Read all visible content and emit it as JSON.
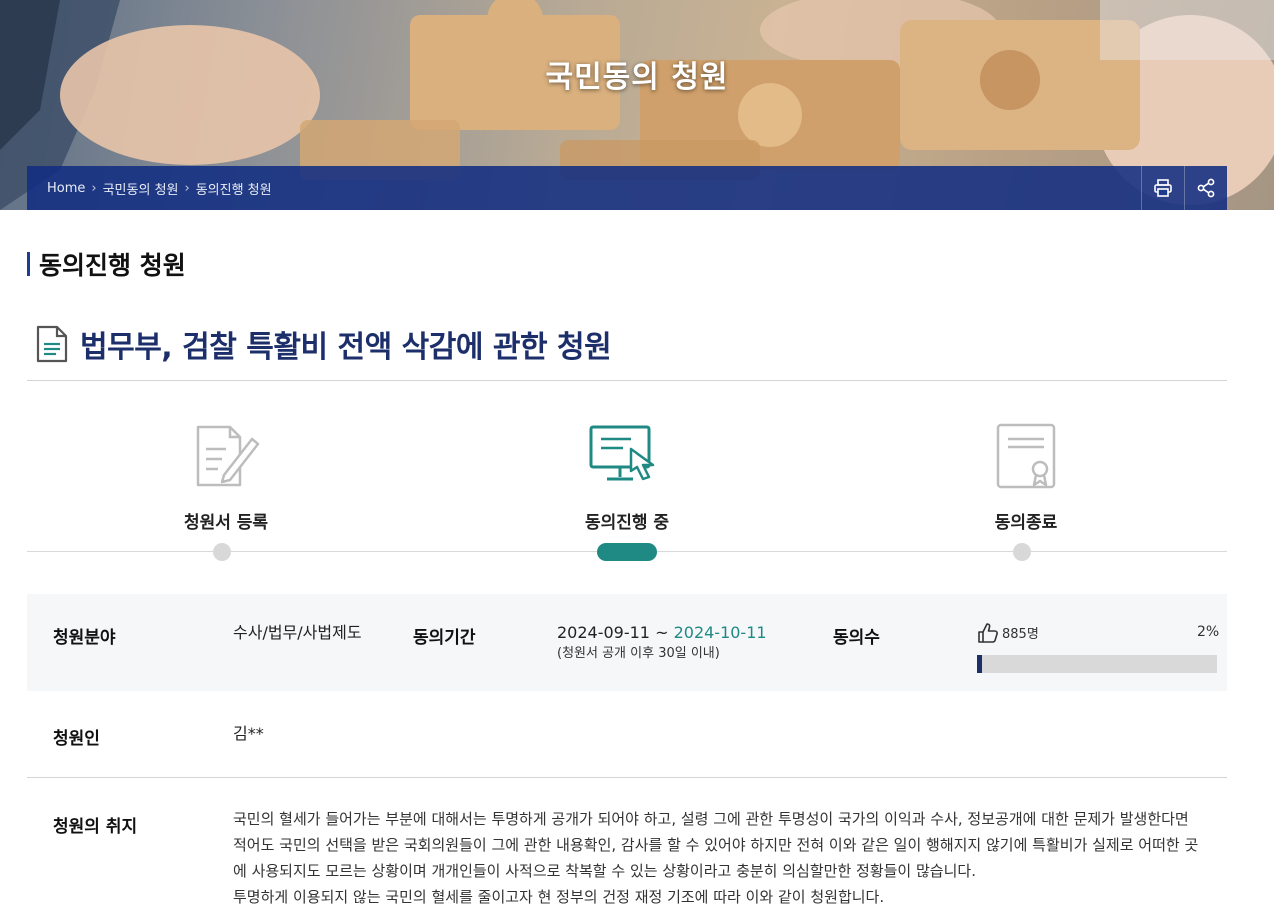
{
  "hero": {
    "title": "국민동의 청원"
  },
  "breadcrumb": {
    "items": [
      "Home",
      "국민동의 청원",
      "동의진행 청원"
    ],
    "separator": "›",
    "print_icon": "print-icon",
    "share_icon": "share-icon"
  },
  "page": {
    "section_title": "동의진행 청원",
    "petition_title": "법무부, 검찰 특활비 전액 삭감에 관한 청원"
  },
  "steps": [
    {
      "label": "청원서 등록",
      "icon": "document-write-icon",
      "status": "done"
    },
    {
      "label": "동의진행 중",
      "icon": "monitor-click-icon",
      "status": "current"
    },
    {
      "label": "동의종료",
      "icon": "certificate-icon",
      "status": "pending"
    }
  ],
  "info": {
    "category_label": "청원분야",
    "category_value": "수사/법무/사법제도",
    "period_label": "동의기간",
    "period_start": "2024-09-11",
    "period_sep": "~",
    "period_end": "2024-10-11",
    "period_note": "(청원서 공개 이후 30일 이내)",
    "count_label": "동의수",
    "count_value": "885명",
    "percent": "2%",
    "progress_fraction": 0.02,
    "petitioner_label": "청원인",
    "petitioner_value": "김**",
    "purpose_label": "청원의 취지",
    "purpose_lines": [
      "국민의 혈세가 들어가는 부분에 대해서는 투명하게 공개가 되어야 하고, 설령 그에 관한 투명성이 국가의 이익과 수사, 정보공개에 대한 문제가 발생한다면",
      "적어도 국민의 선택을 받은 국회의원들이 그에 관한 내용확인, 감사를 할 수 있어야 하지만 전혀 이와 같은 일이 행해지지 않기에 특활비가 실제로 어떠한 곳",
      "에 사용되지도 모르는 상황이며 개개인들이 사적으로 착복할 수 있는 상황이라고 충분히 의심할만한 정황들이 많습니다.",
      "투명하게 이용되지 않는 국민의 혈세를 줄이고자 현 정부의 건정 재정 기조에 따라 이와 같이 청원합니다."
    ]
  },
  "colors": {
    "navy": "#1c2f6b",
    "teal": "#1f8a84",
    "breadcrumb_bg": "#122d82"
  }
}
